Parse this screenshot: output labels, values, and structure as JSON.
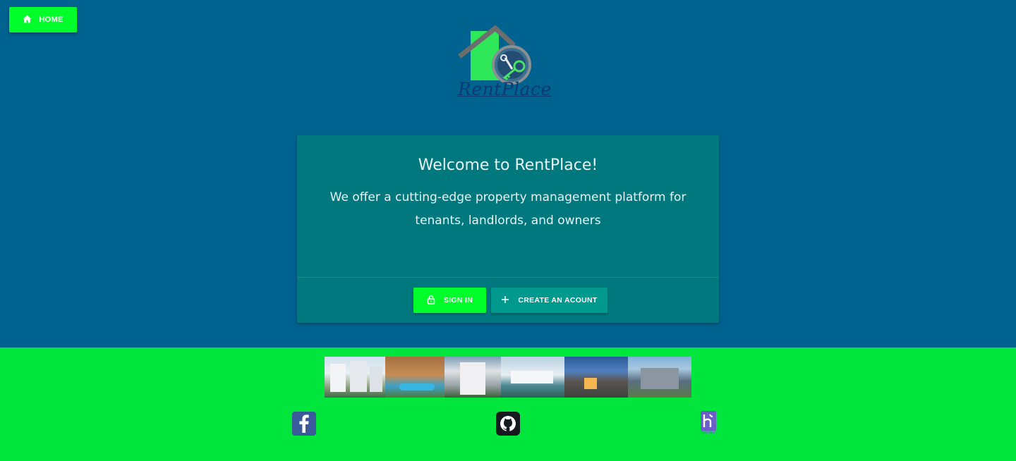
{
  "nav": {
    "home_label": "HOME",
    "home_icon": "home-icon"
  },
  "brand": {
    "logo_text": "RentPlace",
    "colors": {
      "house_green": "#2ee85a",
      "roof_grey": "#6d6d6d",
      "key_green": "#49e26a",
      "text_navy": "#0d3a73"
    }
  },
  "hero": {
    "title": "Welcome to RentPlace!",
    "subtitle": "We offer a cutting-edge property management platform for tenants, landlords, and owners"
  },
  "actions": {
    "signin_label": "SIGN IN",
    "signin_icon": "lock-icon",
    "create_label": "CREATE AN ACOUNT",
    "create_icon": "plus-icon"
  },
  "footer": {
    "gallery": [
      "apartment-towers-photo",
      "pool-resort-photo",
      "apartment-block-photo",
      "modern-villa-photo",
      "modern-house-photo",
      "suburban-house-photo"
    ],
    "social": [
      {
        "name": "facebook-icon"
      },
      {
        "name": "github-icon"
      },
      {
        "name": "heroku-icon",
        "caption": "heroku"
      }
    ]
  },
  "theme": {
    "background": "#00628f",
    "card": "#00787e",
    "accent_green": "#00ff2a",
    "teal_button": "#00998e",
    "footer_green": "#00e63c"
  }
}
